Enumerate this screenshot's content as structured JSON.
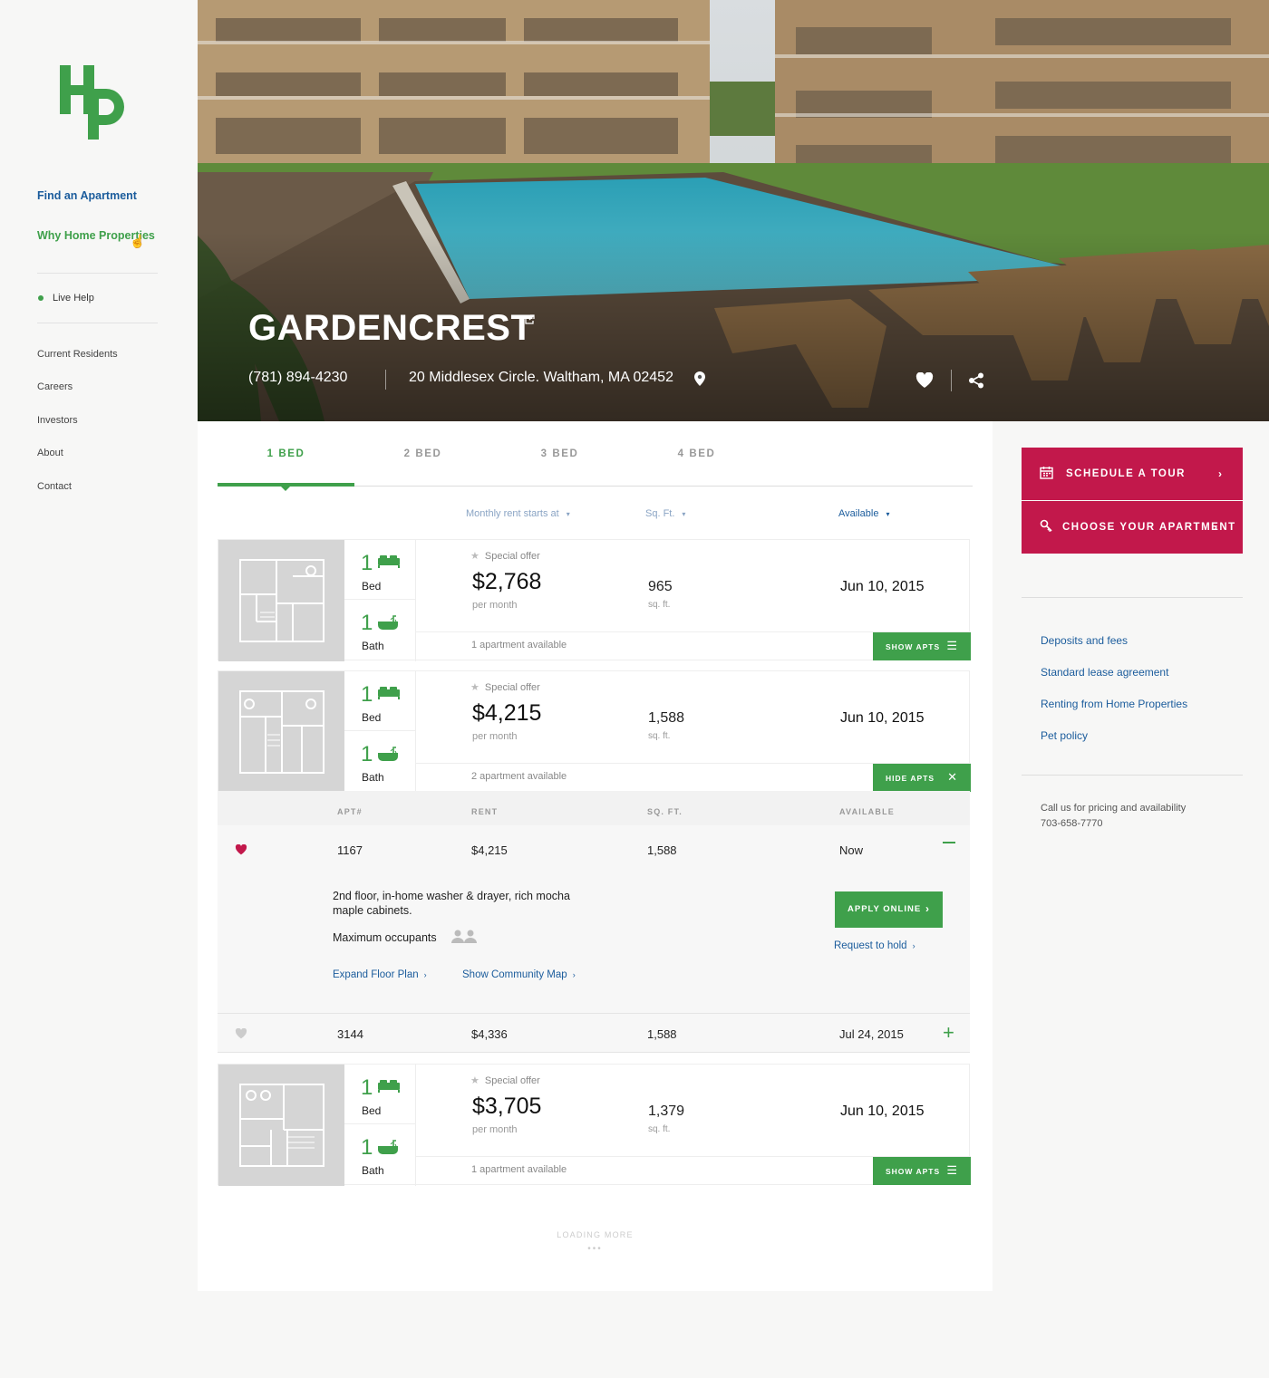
{
  "brand": {
    "logo_letters": "Hp",
    "accent": "#3fa04b",
    "cta": "#c2184b",
    "link": "#1b5c9c"
  },
  "nav": {
    "primary": [
      {
        "label": "Find an Apartment"
      },
      {
        "label": "Why Home Properties"
      }
    ],
    "live_help": "Live Help",
    "secondary": [
      {
        "label": "Current Residents"
      },
      {
        "label": "Careers"
      },
      {
        "label": "Investors"
      },
      {
        "label": "About"
      },
      {
        "label": "Contact"
      }
    ]
  },
  "hero": {
    "title": "GARDENCREST",
    "phone": "(781) 894-4230",
    "address": "20 Middlesex Circle. Waltham, MA 02452",
    "icons": [
      "external-link-icon",
      "map-pin-icon",
      "heart-icon",
      "share-icon"
    ]
  },
  "tabs": [
    {
      "label": "1 BED",
      "active": true
    },
    {
      "label": "2 BED",
      "active": false
    },
    {
      "label": "3 BED",
      "active": false
    },
    {
      "label": "4 BED",
      "active": false
    }
  ],
  "sort": {
    "rent": "Monthly rent starts at",
    "sqft": "Sq. Ft.",
    "available": "Available"
  },
  "units": [
    {
      "beds": "1",
      "bed_label": "Bed",
      "baths": "1",
      "bath_label": "Bath",
      "offer": "Special offer",
      "price": "$2,768",
      "per": "per month",
      "sqft": "965",
      "sqft_label": "sq. ft.",
      "available": "Jun 10, 2015",
      "count": "1 apartment available",
      "button": "SHOW APTS"
    },
    {
      "beds": "1",
      "bed_label": "Bed",
      "baths": "1",
      "bath_label": "Bath",
      "offer": "Special offer",
      "price": "$4,215",
      "per": "per month",
      "sqft": "1,588",
      "sqft_label": "sq. ft.",
      "available": "Jun 10, 2015",
      "count": "2 apartment available",
      "button": "HIDE APTS"
    },
    {
      "beds": "1",
      "bed_label": "Bed",
      "baths": "1",
      "bath_label": "Bath",
      "offer": "Special offer",
      "price": "$3,705",
      "per": "per month",
      "sqft": "1,379",
      "sqft_label": "sq. ft.",
      "available": "Jun 10, 2015",
      "count": "1 apartment available",
      "button": "SHOW APTS"
    }
  ],
  "apt_table": {
    "headers": [
      "APT#",
      "RENT",
      "SQ. FT.",
      "AVAILABLE"
    ],
    "rows": [
      {
        "apt": "1167",
        "rent": "$4,215",
        "sqft": "1,588",
        "available": "Now",
        "favorited": true
      },
      {
        "apt": "3144",
        "rent": "$4,336",
        "sqft": "1,588",
        "available": "Jul 24, 2015",
        "favorited": false
      }
    ],
    "detail": {
      "description": "2nd floor, in-home washer & drayer, rich mocha maple cabinets.",
      "max_occupants": "Maximum occupants",
      "occupants": 2,
      "apply": "APPLY ONLINE",
      "hold": "Request to hold",
      "floor_plan": "Expand Floor Plan",
      "community_map": "Show Community Map"
    }
  },
  "loading": "LOADING MORE",
  "right": {
    "schedule": "SCHEDULE A TOUR",
    "choose": "CHOOSE YOUR APARTMENT",
    "links": [
      "Deposits and fees",
      "Standard lease agreement",
      "Renting from Home Properties",
      "Pet policy"
    ],
    "call_note": "Call us for pricing and availability",
    "call_phone": "703-658-7770"
  }
}
